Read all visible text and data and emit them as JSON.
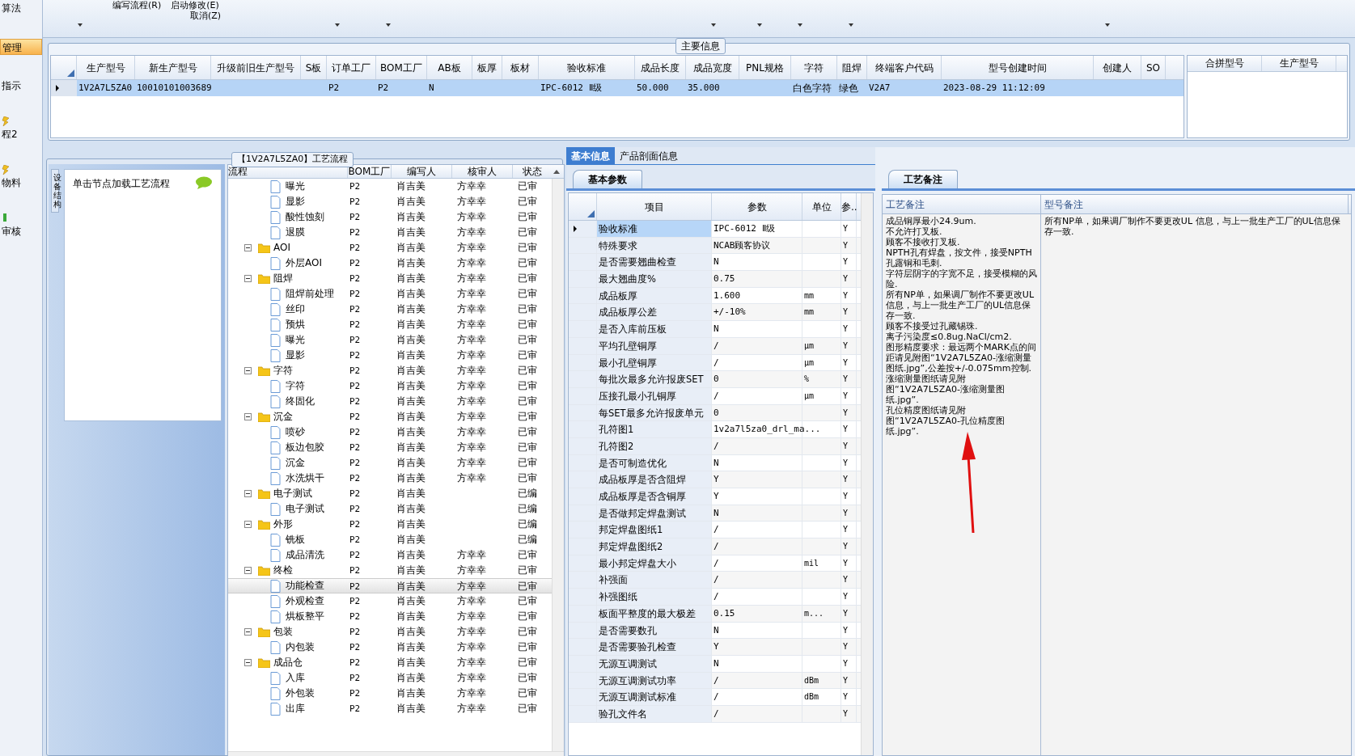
{
  "sidebar": {
    "items": [
      {
        "label": "算法",
        "selected": false,
        "icon": false
      },
      {
        "label": "管理",
        "selected": true,
        "icon": false
      },
      {
        "label": "指示",
        "selected": false,
        "icon": false
      },
      {
        "label": "程2",
        "selected": false,
        "icon": true
      },
      {
        "label": "物料",
        "selected": false,
        "icon": true
      },
      {
        "label": "审核",
        "selected": false,
        "icon": true
      }
    ]
  },
  "toolbar": {
    "items": [
      {
        "label": "编写流程(R)"
      },
      {
        "label": "启动修改(E)"
      },
      {
        "label": "取消(Z)"
      }
    ]
  },
  "main_info": {
    "title": "主要信息",
    "columns": [
      "生产型号",
      "新生产型号",
      "升级前旧生产型号",
      "S板",
      "订单工厂",
      "BOM工厂",
      "AB板",
      "板厚",
      "板材",
      "验收标准",
      "成品长度",
      "成品宽度",
      "PNL规格",
      "字符",
      "阻焊",
      "终端客户代码",
      "型号创建时间",
      "创建人",
      "SO"
    ],
    "rows": [
      {
        "selected": true,
        "cells": [
          "1V2A7L5ZA0",
          "10010101003689",
          null,
          null,
          "P2",
          "P2",
          "N",
          null,
          null,
          "IPC-6012 Ⅱ级",
          "50.000",
          "35.000",
          null,
          "白色字符",
          "绿色",
          "V2A7",
          "2023-08-29 11:12:09",
          null,
          null
        ]
      }
    ],
    "merge_columns": [
      "合拼型号",
      "生产型号"
    ]
  },
  "flow": {
    "title": "【1V2A7L5ZA0】工艺流程",
    "side_tab": "设备结构",
    "hint": "单击节点加载工艺流程",
    "columns": [
      "流程",
      "BOM工厂",
      "编写人",
      "核审人",
      "状态"
    ],
    "tree": [
      {
        "children": [
          {
            "kind": "file",
            "name": "曝光",
            "bom": "P2",
            "writer": "肖吉美",
            "reviewer": "方幸幸",
            "status": "已审",
            "selected": false
          },
          {
            "kind": "file",
            "name": "显影",
            "bom": "P2",
            "writer": "肖吉美",
            "reviewer": "方幸幸",
            "status": "已审",
            "selected": false
          },
          {
            "kind": "file",
            "name": "酸性蚀刻",
            "bom": "P2",
            "writer": "肖吉美",
            "reviewer": "方幸幸",
            "status": "已审",
            "selected": false
          },
          {
            "kind": "file",
            "name": "退膜",
            "bom": "P2",
            "writer": "肖吉美",
            "reviewer": "方幸幸",
            "status": "已审",
            "selected": false
          }
        ]
      },
      {
        "kind": "folder",
        "name": "AOI",
        "bom": "P2",
        "writer": "肖吉美",
        "reviewer": "方幸幸",
        "status": "已审",
        "selected": false,
        "expanded": true,
        "children": [
          {
            "kind": "file",
            "name": "外层AOI",
            "bom": "P2",
            "writer": "肖吉美",
            "reviewer": "方幸幸",
            "status": "已审",
            "selected": false
          }
        ]
      },
      {
        "kind": "folder",
        "name": "阻焊",
        "bom": "P2",
        "writer": "肖吉美",
        "reviewer": "方幸幸",
        "status": "已审",
        "selected": false,
        "expanded": true,
        "children": [
          {
            "kind": "file",
            "name": "阻焊前处理",
            "bom": "P2",
            "writer": "肖吉美",
            "reviewer": "方幸幸",
            "status": "已审",
            "selected": false
          },
          {
            "kind": "file",
            "name": "丝印",
            "bom": "P2",
            "writer": "肖吉美",
            "reviewer": "方幸幸",
            "status": "已审",
            "selected": false
          },
          {
            "kind": "file",
            "name": "预烘",
            "bom": "P2",
            "writer": "肖吉美",
            "reviewer": "方幸幸",
            "status": "已审",
            "selected": false
          },
          {
            "kind": "file",
            "name": "曝光",
            "bom": "P2",
            "writer": "肖吉美",
            "reviewer": "方幸幸",
            "status": "已审",
            "selected": false
          },
          {
            "kind": "file",
            "name": "显影",
            "bom": "P2",
            "writer": "肖吉美",
            "reviewer": "方幸幸",
            "status": "已审",
            "selected": false
          }
        ]
      },
      {
        "kind": "folder",
        "name": "字符",
        "bom": "P2",
        "writer": "肖吉美",
        "reviewer": "方幸幸",
        "status": "已审",
        "selected": false,
        "expanded": true,
        "children": [
          {
            "kind": "file",
            "name": "字符",
            "bom": "P2",
            "writer": "肖吉美",
            "reviewer": "方幸幸",
            "status": "已审",
            "selected": false
          },
          {
            "kind": "file",
            "name": "终固化",
            "bom": "P2",
            "writer": "肖吉美",
            "reviewer": "方幸幸",
            "status": "已审",
            "selected": false
          }
        ]
      },
      {
        "kind": "folder",
        "name": "沉金",
        "bom": "P2",
        "writer": "肖吉美",
        "reviewer": "方幸幸",
        "status": "已审",
        "selected": false,
        "expanded": true,
        "children": [
          {
            "kind": "file",
            "name": "喷砂",
            "bom": "P2",
            "writer": "肖吉美",
            "reviewer": "方幸幸",
            "status": "已审",
            "selected": false
          },
          {
            "kind": "file",
            "name": "板边包胶",
            "bom": "P2",
            "writer": "肖吉美",
            "reviewer": "方幸幸",
            "status": "已审",
            "selected": false
          },
          {
            "kind": "file",
            "name": "沉金",
            "bom": "P2",
            "writer": "肖吉美",
            "reviewer": "方幸幸",
            "status": "已审",
            "selected": false
          },
          {
            "kind": "file",
            "name": "水洗烘干",
            "bom": "P2",
            "writer": "肖吉美",
            "reviewer": "方幸幸",
            "status": "已审",
            "selected": false
          }
        ]
      },
      {
        "kind": "folder",
        "name": "电子测试",
        "bom": "P2",
        "writer": "肖吉美",
        "status": "已编",
        "selected": false,
        "expanded": true,
        "children": [
          {
            "kind": "file",
            "name": "电子测试",
            "bom": "P2",
            "writer": "肖吉美",
            "status": "已编",
            "selected": false
          }
        ]
      },
      {
        "kind": "folder",
        "name": "外形",
        "bom": "P2",
        "writer": "肖吉美",
        "status": "已编",
        "selected": false,
        "expanded": true,
        "children": [
          {
            "kind": "file",
            "name": "铣板",
            "bom": "P2",
            "writer": "肖吉美",
            "status": "已编",
            "selected": false
          },
          {
            "kind": "file",
            "name": "成品清洗",
            "bom": "P2",
            "writer": "肖吉美",
            "reviewer": "方幸幸",
            "status": "已审",
            "selected": false
          }
        ]
      },
      {
        "kind": "folder",
        "name": "终检",
        "bom": "P2",
        "writer": "肖吉美",
        "reviewer": "方幸幸",
        "status": "已审",
        "selected": false,
        "expanded": true,
        "children": [
          {
            "kind": "file",
            "name": "功能检查",
            "bom": "P2",
            "writer": "肖吉美",
            "reviewer": "方幸幸",
            "status": "已审",
            "selected": true
          },
          {
            "kind": "file",
            "name": "外观检查",
            "bom": "P2",
            "writer": "肖吉美",
            "reviewer": "方幸幸",
            "status": "已审",
            "selected": false
          },
          {
            "kind": "file",
            "name": "烘板整平",
            "bom": "P2",
            "writer": "肖吉美",
            "reviewer": "方幸幸",
            "status": "已审",
            "selected": false
          }
        ]
      },
      {
        "kind": "folder",
        "name": "包装",
        "bom": "P2",
        "writer": "肖吉美",
        "reviewer": "方幸幸",
        "status": "已审",
        "selected": false,
        "expanded": true,
        "children": [
          {
            "kind": "file",
            "name": "内包装",
            "bom": "P2",
            "writer": "肖吉美",
            "reviewer": "方幸幸",
            "status": "已审",
            "selected": false
          }
        ]
      },
      {
        "kind": "folder",
        "name": "成品仓",
        "bom": "P2",
        "writer": "肖吉美",
        "reviewer": "方幸幸",
        "status": "已审",
        "selected": false,
        "expanded": true,
        "children": [
          {
            "kind": "file",
            "name": "入库",
            "bom": "P2",
            "writer": "肖吉美",
            "reviewer": "方幸幸",
            "status": "已审",
            "selected": false
          },
          {
            "kind": "file",
            "name": "外包装",
            "bom": "P2",
            "writer": "肖吉美",
            "reviewer": "方幸幸",
            "status": "已审",
            "selected": false
          },
          {
            "kind": "file",
            "name": "出库",
            "bom": "P2",
            "writer": "肖吉美",
            "reviewer": "方幸幸",
            "status": "已审",
            "selected": false
          }
        ]
      }
    ]
  },
  "detail_tabs": [
    {
      "label": "基本信息",
      "selected": true
    },
    {
      "label": "产品剖面信息",
      "selected": false
    }
  ],
  "params": {
    "tab": "基本参数",
    "columns": [
      "项目",
      "参数",
      "单位",
      "参.."
    ],
    "rows": [
      {
        "item": "验收标准",
        "value": "IPC-6012 Ⅱ级",
        "flag": "Y",
        "selected": true
      },
      {
        "item": "特殊要求",
        "value": "NCAB顾客协议",
        "flag": "Y",
        "selected": false
      },
      {
        "item": "是否需要翘曲检查",
        "value": "N",
        "flag": "Y",
        "selected": false
      },
      {
        "item": "最大翘曲度%",
        "value": "0.75",
        "flag": "Y",
        "selected": false
      },
      {
        "item": "成品板厚",
        "value": "1.600",
        "unit": "mm",
        "flag": "Y",
        "selected": false
      },
      {
        "item": "成品板厚公差",
        "value": "+/-10%",
        "unit": "mm",
        "flag": "Y",
        "selected": false
      },
      {
        "item": "是否入库前压板",
        "value": "N",
        "flag": "Y",
        "selected": false
      },
      {
        "item": "平均孔壁铜厚",
        "value": "/",
        "unit": "μm",
        "flag": "Y",
        "selected": false
      },
      {
        "item": "最小孔壁铜厚",
        "value": "/",
        "unit": "μm",
        "flag": "Y",
        "selected": false
      },
      {
        "item": "每批次最多允许报废SET",
        "value": "0",
        "unit": "%",
        "flag": "Y",
        "selected": false
      },
      {
        "item": "压接孔最小孔铜厚",
        "value": "/",
        "unit": "μm",
        "flag": "Y",
        "selected": false
      },
      {
        "item": "每SET最多允许报废单元",
        "value": "0",
        "flag": "Y",
        "selected": false
      },
      {
        "item": "孔符图1",
        "value": "1v2a7l5za0_drl_ma...",
        "flag": "Y",
        "selected": false
      },
      {
        "item": "孔符图2",
        "value": "/",
        "flag": "Y",
        "selected": false
      },
      {
        "item": "是否可制造优化",
        "value": "N",
        "flag": "Y",
        "selected": false
      },
      {
        "item": "成品板厚是否含阻焊",
        "value": "Y",
        "flag": "Y",
        "selected": false
      },
      {
        "item": "成品板厚是否含铜厚",
        "value": "Y",
        "flag": "Y",
        "selected": false
      },
      {
        "item": "是否做邦定焊盘测试",
        "value": "N",
        "flag": "Y",
        "selected": false
      },
      {
        "item": "邦定焊盘图纸1",
        "value": "/",
        "flag": "Y",
        "selected": false
      },
      {
        "item": "邦定焊盘图纸2",
        "value": "/",
        "flag": "Y",
        "selected": false
      },
      {
        "item": "最小邦定焊盘大小",
        "value": "/",
        "unit": "mil",
        "flag": "Y",
        "selected": false
      },
      {
        "item": "补强面",
        "value": "/",
        "flag": "Y",
        "selected": false
      },
      {
        "item": "补强图纸",
        "value": "/",
        "flag": "Y",
        "selected": false
      },
      {
        "item": "板面平整度的最大极差",
        "value": "0.15",
        "unit": "m...",
        "flag": "Y",
        "selected": false
      },
      {
        "item": "是否需要数孔",
        "value": "N",
        "flag": "Y",
        "selected": false
      },
      {
        "item": "是否需要验孔检查",
        "value": "Y",
        "flag": "Y",
        "selected": false
      },
      {
        "item": "无源互调测试",
        "value": "N",
        "flag": "Y",
        "selected": false
      },
      {
        "item": "无源互调测试功率",
        "value": "/",
        "unit": "dBm",
        "flag": "Y",
        "selected": false
      },
      {
        "item": "无源互调测试标准",
        "value": "/",
        "unit": "dBm",
        "flag": "Y",
        "selected": false
      },
      {
        "item": "验孔文件名",
        "value": "/",
        "flag": "Y",
        "selected": false
      }
    ]
  },
  "remarks": {
    "tab": "工艺备注",
    "columns": [
      "工艺备注",
      "型号备注"
    ],
    "process_note": "成品铜厚最小24.9um.\n不允许打叉板.\n顾客不接收打叉板.\nNPTH孔有焊盘，按文件，接受NPTH孔露铜和毛刺.\n字符层阴字的字宽不足，接受模糊的风险.\n所有NP单，如果调厂制作不要更改UL 信息，与上一批生产工厂的UL信息保存一致.\n顾客不接受过孔藏锡珠.\n离子污染度≤0.8ug.NaCl/cm2.\n图形精度要求：最远两个MARK点的间距请见附图“1V2A7L5ZA0-涨缩测量图纸.jpg”,公差按+/-0.075mm控制.\n涨缩测量图纸请见附图“1V2A7L5ZA0-涨缩测量图纸.jpg”.\n孔位精度图纸请见附图“1V2A7L5ZA0-孔位精度图纸.jpg”.",
    "model_note": "所有NP单，如果调厂制作不要更改UL 信息，与上一批生产工厂的UL信息保存一致."
  }
}
